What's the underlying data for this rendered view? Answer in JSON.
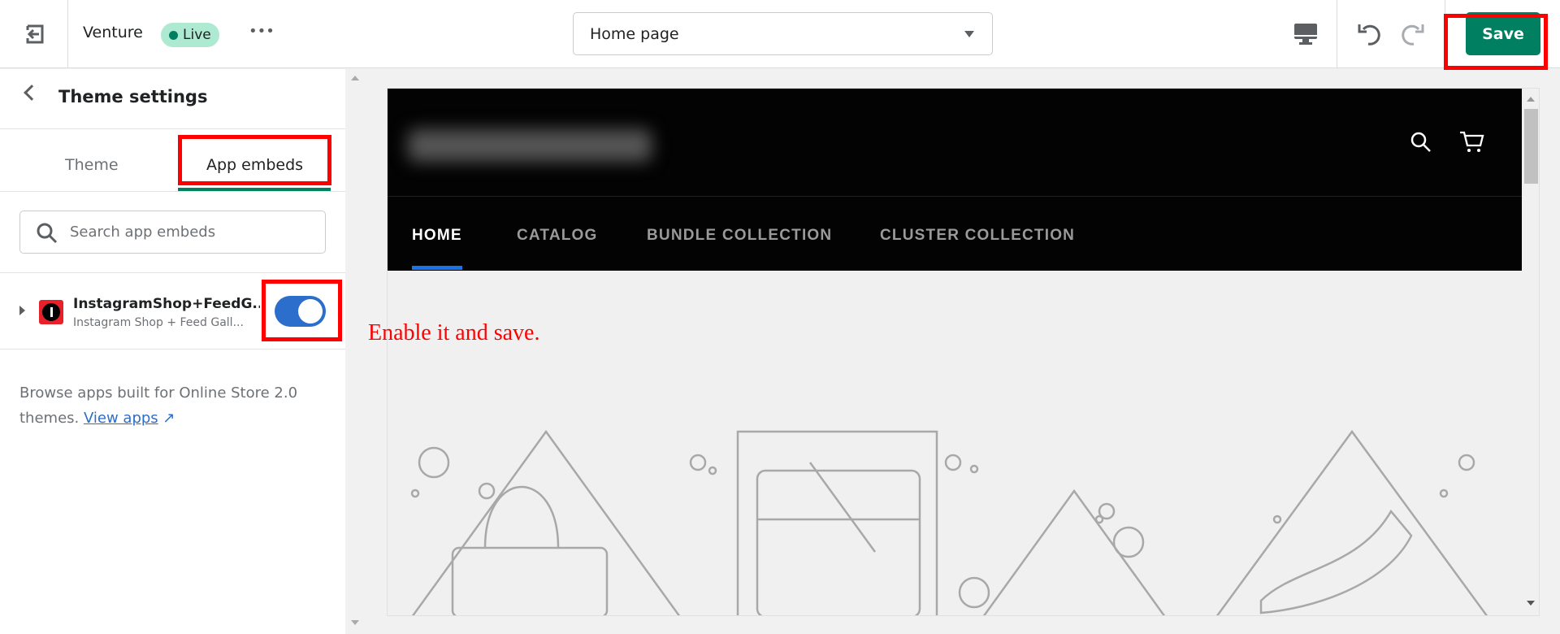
{
  "topbar": {
    "theme_name": "Venture",
    "status": "Live",
    "more": "•••",
    "page_select": "Home page",
    "save_label": "Save"
  },
  "sidebar": {
    "title": "Theme settings",
    "tabs": [
      {
        "label": "Theme"
      },
      {
        "label": "App embeds",
        "active": true
      }
    ],
    "search_placeholder": "Search app embeds",
    "app": {
      "name": "InstagramShop+FeedG...",
      "subtitle": "Instagram Shop + Feed Gall...",
      "enabled": true
    },
    "browse_text": "Browse apps built for Online Store 2.0 themes.",
    "view_apps": "View apps"
  },
  "preview": {
    "nav": [
      "HOME",
      "CATALOG",
      "BUNDLE COLLECTION",
      "CLUSTER COLLECTION"
    ],
    "active_nav": "HOME"
  },
  "annotation": "Enable it and save.",
  "colors": {
    "accent": "#008060",
    "toggle": "#2c6ecb",
    "annotation": "#ff0000",
    "live_badge": "#aee9d1"
  }
}
